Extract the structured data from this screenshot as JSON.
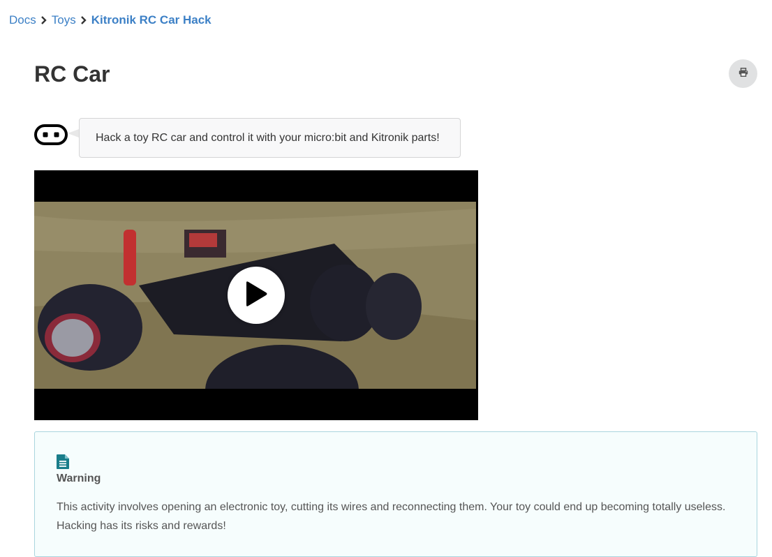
{
  "breadcrumb": {
    "items": [
      {
        "label": "Docs"
      },
      {
        "label": "Toys"
      },
      {
        "label": "Kitronik RC Car Hack"
      }
    ]
  },
  "page": {
    "title": "RC Car"
  },
  "intro": {
    "text": "Hack a toy RC car and control it with your micro:bit and Kitronik parts!"
  },
  "video": {
    "play_icon": "play-icon"
  },
  "callout": {
    "icon": "document-icon",
    "title": "Warning",
    "text": "This activity involves opening an electronic toy, cutting its wires and reconnecting them. Your toy could end up becoming totally useless. Hacking has its risks and rewards!"
  },
  "colors": {
    "link": "#3c80c6",
    "callout_border": "#a9d5de",
    "callout_icon": "#1a7d8a",
    "print_button_bg": "#e0e1e2"
  }
}
